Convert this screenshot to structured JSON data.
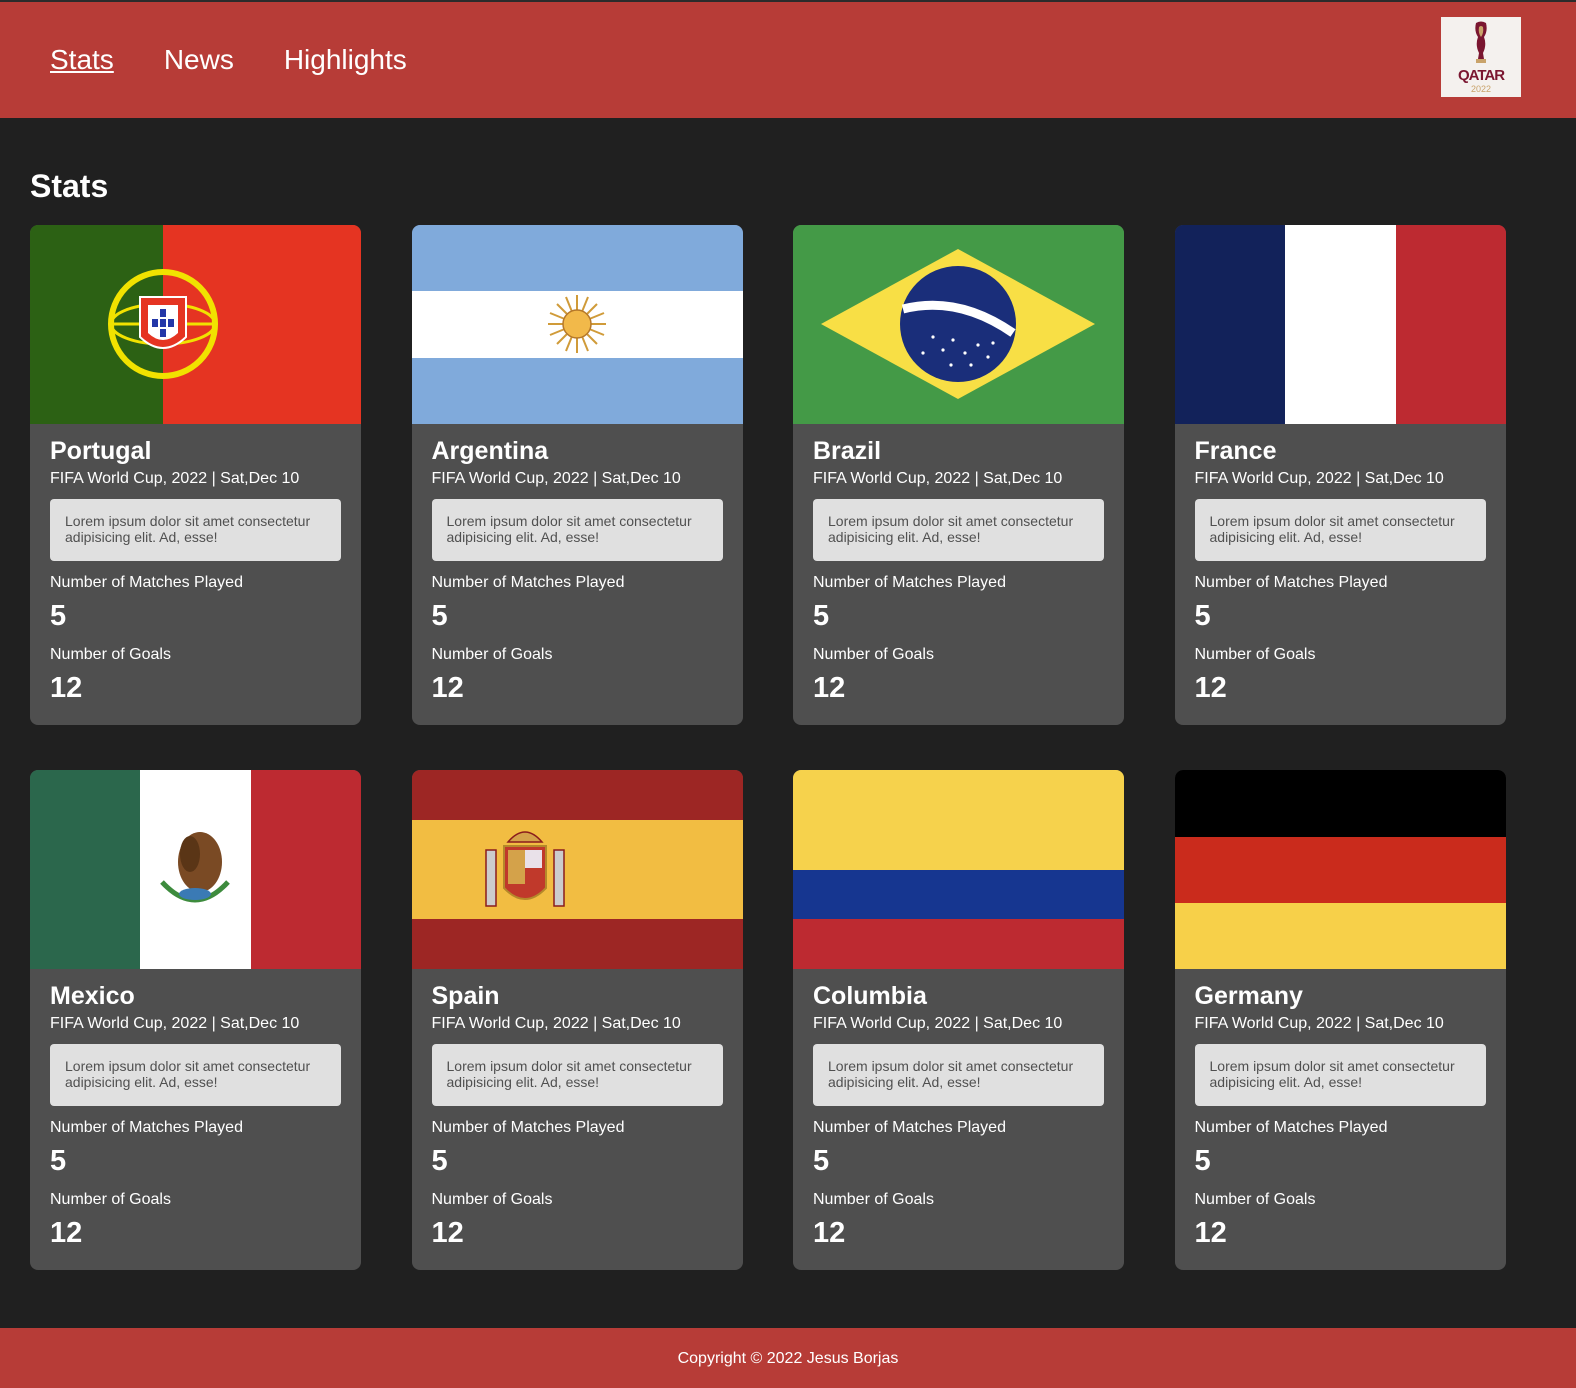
{
  "nav": {
    "items": [
      "Stats",
      "News",
      "Highlights"
    ],
    "active": "Stats"
  },
  "logo": {
    "text": "QATAR",
    "year": "2022"
  },
  "page_title": "Stats",
  "labels": {
    "matches": "Number of Matches Played",
    "goals": "Number of Goals"
  },
  "cards": [
    {
      "country": "Portugal",
      "flag": "portugal-flag",
      "event": "FIFA World Cup, 2022 | Sat,Dec 10",
      "description": "Lorem ipsum dolor sit amet consectetur adipisicing elit. Ad, esse!",
      "matches": "5",
      "goals": "12"
    },
    {
      "country": "Argentina",
      "flag": "argentina-flag",
      "event": "FIFA World Cup, 2022 | Sat,Dec 10",
      "description": "Lorem ipsum dolor sit amet consectetur adipisicing elit. Ad, esse!",
      "matches": "5",
      "goals": "12"
    },
    {
      "country": "Brazil",
      "flag": "brazil-flag",
      "event": "FIFA World Cup, 2022 | Sat,Dec 10",
      "description": "Lorem ipsum dolor sit amet consectetur adipisicing elit. Ad, esse!",
      "matches": "5",
      "goals": "12"
    },
    {
      "country": "France",
      "flag": "france-flag",
      "event": "FIFA World Cup, 2022 | Sat,Dec 10",
      "description": "Lorem ipsum dolor sit amet consectetur adipisicing elit. Ad, esse!",
      "matches": "5",
      "goals": "12"
    },
    {
      "country": "Mexico",
      "flag": "mexico-flag",
      "event": "FIFA World Cup, 2022 | Sat,Dec 10",
      "description": "Lorem ipsum dolor sit amet consectetur adipisicing elit. Ad, esse!",
      "matches": "5",
      "goals": "12"
    },
    {
      "country": "Spain",
      "flag": "spain-flag",
      "event": "FIFA World Cup, 2022 | Sat,Dec 10",
      "description": "Lorem ipsum dolor sit amet consectetur adipisicing elit. Ad, esse!",
      "matches": "5",
      "goals": "12"
    },
    {
      "country": "Columbia",
      "flag": "colombia-flag",
      "event": "FIFA World Cup, 2022 | Sat,Dec 10",
      "description": "Lorem ipsum dolor sit amet consectetur adipisicing elit. Ad, esse!",
      "matches": "5",
      "goals": "12"
    },
    {
      "country": "Germany",
      "flag": "germany-flag",
      "event": "FIFA World Cup, 2022 | Sat,Dec 10",
      "description": "Lorem ipsum dolor sit amet consectetur adipisicing elit. Ad, esse!",
      "matches": "5",
      "goals": "12"
    }
  ],
  "footer": {
    "text": "Copyright © 2022 Jesus Borjas"
  },
  "colors": {
    "header": "#b73c37",
    "background": "#202020",
    "card": "#4f4f4f",
    "description_box": "#e0e0e0"
  }
}
